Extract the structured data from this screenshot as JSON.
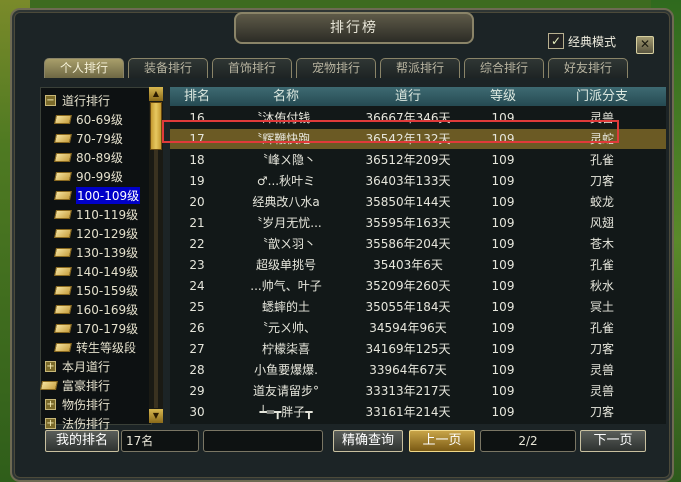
{
  "window": {
    "title": "排行榜",
    "classic_mode_label": "经典模式",
    "classic_mode_checked": "✓",
    "close_label": "✕"
  },
  "tabs": [
    {
      "label": "个人排行",
      "active": true
    },
    {
      "label": "装备排行"
    },
    {
      "label": "首饰排行"
    },
    {
      "label": "宠物排行"
    },
    {
      "label": "帮派排行"
    },
    {
      "label": "综合排行"
    },
    {
      "label": "好友排行"
    }
  ],
  "tree": {
    "items": [
      {
        "label": "道行排行",
        "type": "expander",
        "symbol": "−"
      },
      {
        "label": "60-69级",
        "type": "book"
      },
      {
        "label": "70-79级",
        "type": "book"
      },
      {
        "label": "80-89级",
        "type": "book"
      },
      {
        "label": "90-99级",
        "type": "book"
      },
      {
        "label": "100-109级",
        "type": "book",
        "selected": true
      },
      {
        "label": "110-119级",
        "type": "book"
      },
      {
        "label": "120-129级",
        "type": "book"
      },
      {
        "label": "130-139级",
        "type": "book"
      },
      {
        "label": "140-149级",
        "type": "book"
      },
      {
        "label": "150-159级",
        "type": "book"
      },
      {
        "label": "160-169级",
        "type": "book"
      },
      {
        "label": "170-179级",
        "type": "book"
      },
      {
        "label": "转生等级段",
        "type": "book"
      },
      {
        "label": "本月道行",
        "type": "expander",
        "symbol": "+"
      },
      {
        "label": "富豪排行",
        "type": "book-top"
      },
      {
        "label": "物伤排行",
        "type": "expander",
        "symbol": "+"
      },
      {
        "label": "法伤排行",
        "type": "expander",
        "symbol": "+"
      }
    ]
  },
  "table": {
    "headers": [
      "排名",
      "名称",
      "道行",
      "等级",
      "门派分支"
    ],
    "rows": [
      [
        "16",
        "〝沐侑付钱...",
        "36667年346天",
        "109",
        "灵兽"
      ],
      [
        "17",
        "〝辉鞭快跑...",
        "36542年132天",
        "109",
        "灵蛇"
      ],
      [
        "18",
        "〝峰ㄨ隐丶",
        "36512年209天",
        "109",
        "孔雀"
      ],
      [
        "19",
        "♂...秋叶ミ",
        "36403年133天",
        "109",
        "刀客"
      ],
      [
        "20",
        "经典改八水a",
        "35850年144天",
        "109",
        "蛟龙"
      ],
      [
        "21",
        "〝岁月无忧...",
        "35595年163天",
        "109",
        "风翅"
      ],
      [
        "22",
        "〝歆ㄨ羽丶",
        "35586年204天",
        "109",
        "苍木"
      ],
      [
        "23",
        "超级单挑号",
        "35403年6天",
        "109",
        "孔雀"
      ],
      [
        "24",
        "...帅气、叶子",
        "35209年260天",
        "109",
        "秋水"
      ],
      [
        "25",
        "蟋蟀的土",
        "35055年184天",
        "109",
        "冥土"
      ],
      [
        "26",
        "〝元ㄨ帅、",
        "34594年96天",
        "109",
        "孔雀"
      ],
      [
        "27",
        "柠檬柒喜",
        "34169年125天",
        "109",
        "刀客"
      ],
      [
        "28",
        "小鱼要爆爆.",
        "33964年67天",
        "109",
        "灵兽"
      ],
      [
        "29",
        "道友请留步°",
        "33313年217天",
        "109",
        "灵兽"
      ],
      [
        "30",
        "┷═┳胖子┳",
        "33161年214天",
        "109",
        "刀客"
      ]
    ],
    "highlighted_row": 1
  },
  "bottom": {
    "my_rank_label": "我的排名",
    "my_rank_value": "17名",
    "query_input_value": "",
    "search_label": "精确查询",
    "prev_label": "上一页",
    "page_indicator": "2/2",
    "next_label": "下一页"
  }
}
